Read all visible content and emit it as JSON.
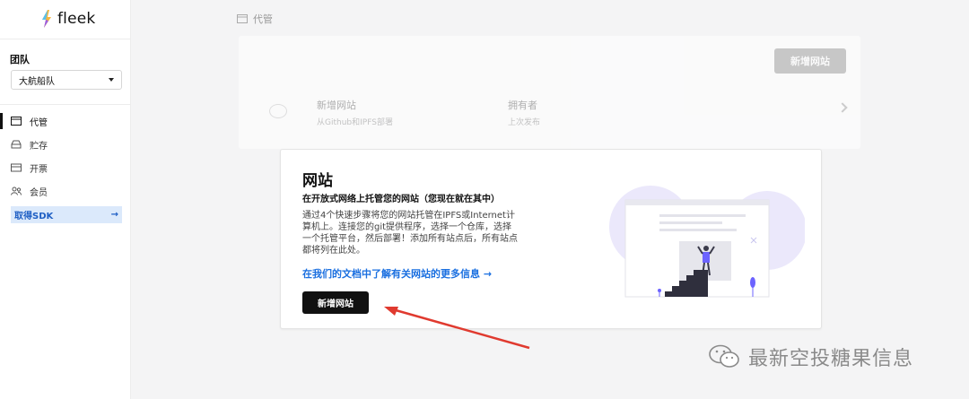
{
  "app": {
    "name": "fleek",
    "accent": "#1f5fc4"
  },
  "sidebar": {
    "team_label": "团队",
    "team_select": {
      "value": "大航船队"
    },
    "items": [
      {
        "label": "代管",
        "icon": "hosting-icon",
        "active": true
      },
      {
        "label": "贮存",
        "icon": "storage-icon",
        "active": false
      },
      {
        "label": "开票",
        "icon": "billing-icon",
        "active": false
      },
      {
        "label": "会员",
        "icon": "members-icon",
        "active": false
      }
    ],
    "sdk": {
      "label": "取得SDK",
      "arrow": "→"
    }
  },
  "topbar": {
    "breadcrumb": "代管"
  },
  "background_card": {
    "add_button": "新增网站",
    "col1_title": "新增网站",
    "col1_sub": "从Github和IPFS部署",
    "col2_title": "拥有者",
    "col2_sub": "上次发布"
  },
  "card": {
    "title": "网站",
    "subtitle": "在开放式网络上托管您的网站（您现在就在其中）",
    "description": "通过4个快速步骤将您的网站托管在IPFS或Internet计算机上。连接您的git提供程序，选择一个仓库，选择一个托管平台，然后部署！添加所有站点后，所有站点都将列在此处。",
    "link": "在我们的文档中了解有关网站的更多信息 →",
    "button": "新增网站"
  },
  "watermark": {
    "text": "最新空投糖果信息"
  },
  "colors": {
    "annotation": "#e03a2f",
    "link": "#1a6fe0",
    "illustration": "#6c63ff"
  }
}
